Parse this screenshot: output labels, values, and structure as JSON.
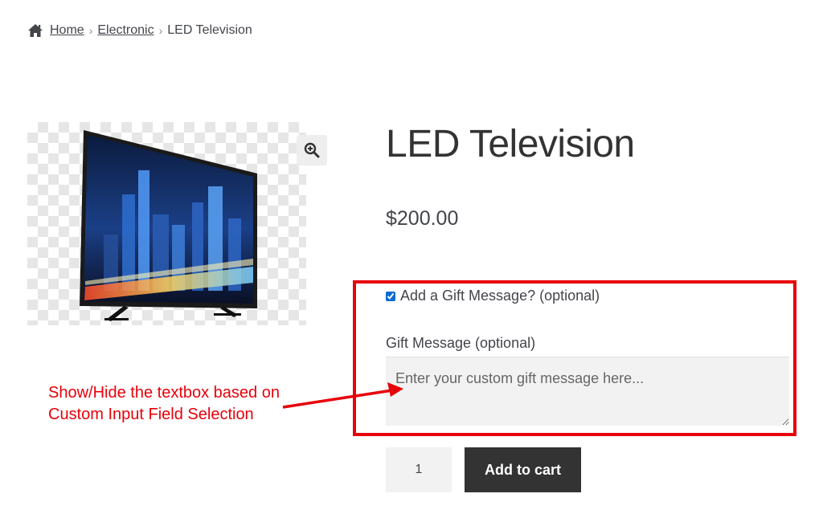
{
  "breadcrumb": {
    "icon": "home-icon",
    "home": "Home",
    "category": "Electronic",
    "current": "LED Television",
    "separator": "›"
  },
  "product": {
    "title": "LED Television",
    "price": "$200.00",
    "image_icon": "television-image",
    "zoom_icon": "zoom-in-icon"
  },
  "gift": {
    "checkbox_label": "Add a Gift Message? (optional)",
    "checkbox_checked": true,
    "message_label": "Gift Message (optional)",
    "message_placeholder": "Enter your custom gift message here...",
    "message_value": ""
  },
  "annotation": {
    "line1": "Show/Hide the textbox based on",
    "line2": "Custom Input Field Selection",
    "color": "#e8000a"
  },
  "cart": {
    "quantity": "1",
    "add_label": "Add to cart"
  }
}
